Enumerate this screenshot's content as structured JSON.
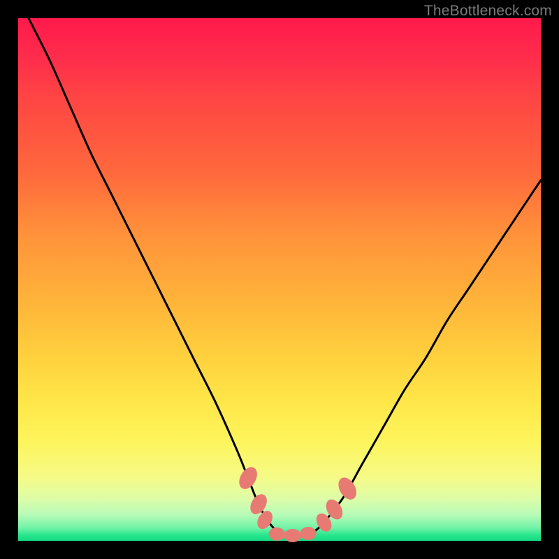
{
  "watermark": "TheBottleneck.com",
  "colors": {
    "frame": "#000000",
    "curve_stroke": "#000000",
    "marker_fill": "#e77b73",
    "marker_stroke": "#e77b73"
  },
  "chart_data": {
    "type": "line",
    "title": "",
    "xlabel": "",
    "ylabel": "",
    "xlim": [
      0,
      100
    ],
    "ylim": [
      0,
      100
    ],
    "grid": false,
    "legend": false,
    "series": [
      {
        "name": "bottleneck-curve",
        "x": [
          2,
          6,
          10,
          14,
          18,
          22,
          26,
          30,
          34,
          38,
          42,
          44,
          46,
          48,
          50,
          52,
          54,
          56,
          58,
          62,
          66,
          70,
          74,
          78,
          82,
          86,
          90,
          94,
          98,
          100
        ],
        "y": [
          100,
          92,
          83,
          74,
          66,
          58,
          50,
          42,
          34,
          26,
          17,
          12,
          7,
          3.5,
          1.5,
          1,
          1,
          1.5,
          3,
          8,
          15,
          22,
          29,
          35,
          42,
          48,
          54,
          60,
          66,
          69
        ]
      }
    ],
    "markers": [
      {
        "name": "left-upper-bead",
        "x": 44.0,
        "y": 12.0,
        "rx": 1.4,
        "ry": 2.2,
        "rot": 30
      },
      {
        "name": "left-mid-bead",
        "x": 46.0,
        "y": 7.0,
        "rx": 1.3,
        "ry": 2.0,
        "rot": 30
      },
      {
        "name": "left-lower-bead",
        "x": 47.2,
        "y": 4.0,
        "rx": 1.2,
        "ry": 1.8,
        "rot": 30
      },
      {
        "name": "bottom-bead-1",
        "x": 49.5,
        "y": 1.3,
        "rx": 1.5,
        "ry": 1.2,
        "rot": 0
      },
      {
        "name": "bottom-bead-2",
        "x": 52.5,
        "y": 1.0,
        "rx": 1.6,
        "ry": 1.2,
        "rot": 0
      },
      {
        "name": "bottom-bead-3",
        "x": 55.5,
        "y": 1.4,
        "rx": 1.5,
        "ry": 1.2,
        "rot": 0
      },
      {
        "name": "right-lower-bead",
        "x": 58.5,
        "y": 3.5,
        "rx": 1.2,
        "ry": 1.8,
        "rot": -30
      },
      {
        "name": "right-mid-bead",
        "x": 60.5,
        "y": 6.0,
        "rx": 1.3,
        "ry": 2.0,
        "rot": -30
      },
      {
        "name": "right-upper-bead",
        "x": 63.0,
        "y": 10.0,
        "rx": 1.4,
        "ry": 2.2,
        "rot": -30
      }
    ]
  }
}
